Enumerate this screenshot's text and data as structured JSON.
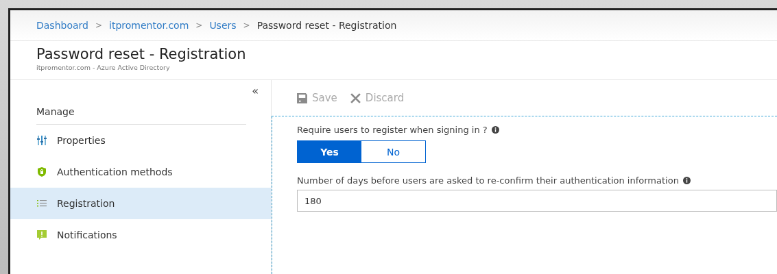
{
  "breadcrumb": [
    {
      "label": "Dashboard",
      "link": true
    },
    {
      "label": "itpromentor.com",
      "link": true
    },
    {
      "label": "Users",
      "link": true
    },
    {
      "label": "Password reset - Registration",
      "link": false
    }
  ],
  "breadcrumb_separator": ">",
  "header": {
    "title": "Password reset - Registration",
    "subtitle": "itpromentor.com - Azure Active Directory"
  },
  "sidebar": {
    "collapse": "«",
    "section": "Manage",
    "items": [
      {
        "label": "Properties",
        "kind": "properties",
        "selected": false
      },
      {
        "label": "Authentication methods",
        "kind": "shield",
        "selected": false
      },
      {
        "label": "Registration",
        "kind": "list",
        "selected": true
      },
      {
        "label": "Notifications",
        "kind": "alert",
        "selected": false
      }
    ]
  },
  "toolbar": [
    {
      "label": "Save",
      "kind": "save",
      "disabled": true
    },
    {
      "label": "Discard",
      "kind": "discard",
      "disabled": true
    }
  ],
  "form": {
    "require_label": "Require users to register when signing in ?",
    "toggle": [
      {
        "label": "Yes",
        "selected": true
      },
      {
        "label": "No",
        "selected": false
      }
    ],
    "days_label": "Number of days before users are asked to re-confirm their authentication information",
    "days_value": "180"
  }
}
